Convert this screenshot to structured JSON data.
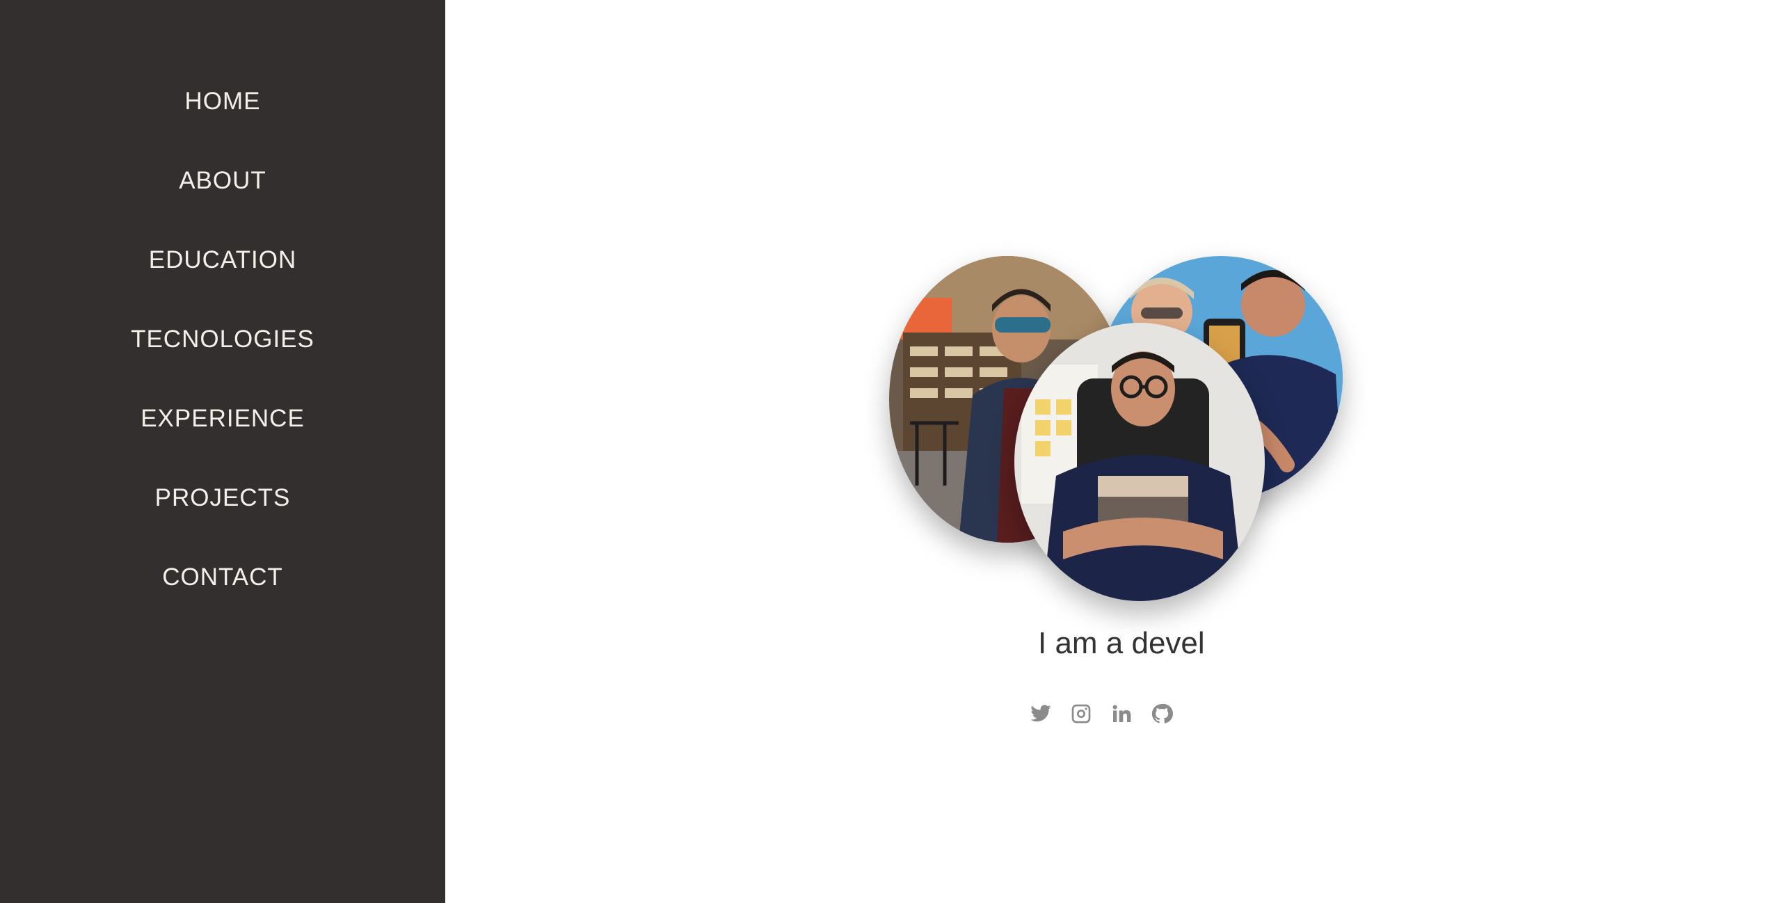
{
  "nav": {
    "items": [
      {
        "label": "HOME"
      },
      {
        "label": "ABOUT"
      },
      {
        "label": "EDUCATION"
      },
      {
        "label": "TECNOLOGIES"
      },
      {
        "label": "EXPERIENCE"
      },
      {
        "label": "PROJECTS"
      },
      {
        "label": "CONTACT"
      }
    ]
  },
  "hero": {
    "tagline": "I am a devel",
    "photos": [
      "photo-cafe",
      "photo-selfie-group",
      "photo-office-chair"
    ]
  },
  "socials": {
    "icons": [
      "twitter-icon",
      "instagram-icon",
      "linkedin-icon",
      "github-icon"
    ]
  },
  "colors": {
    "sidebar_bg": "#332f2f",
    "nav_text": "#f3f0ea",
    "icon_grey": "#8b8b8b",
    "tagline_text": "#333333"
  }
}
